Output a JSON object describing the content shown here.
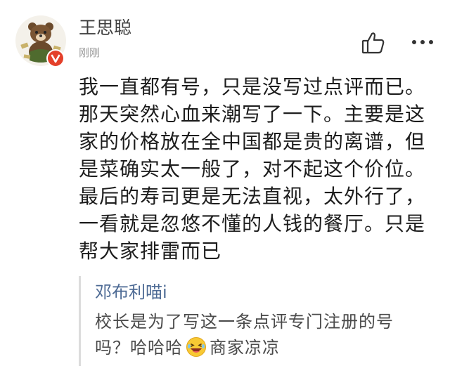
{
  "comment": {
    "username": "王思聪",
    "timestamp": "刚刚",
    "body": "我一直都有号，只是没写过点评而已。那天突然心血来潮写了一下。主要是这家的价格放在全中国都是贵的离谱，但是菜确实太一般了，对不起这个价位。最后的寿司更是无法直视，太外行了，一看就是忽悠不懂的人钱的餐厅。只是帮大家排雷而已"
  },
  "reply": {
    "author": "邓布利喵i",
    "text_before_emoji": "校长是为了写这一条点评专门注册的号吗？哈哈哈",
    "emoji": "laughing-emoji",
    "text_after_emoji": "商家凉凉"
  },
  "icons": {
    "like": "thumbs-up-icon",
    "more": "more-dots-icon",
    "verified": "verified-badge-icon",
    "avatar": "bear-avatar"
  },
  "colors": {
    "verified_badge": "#e4402a",
    "reply_author": "#4d6a94",
    "reply_border": "#dcdcdc"
  }
}
